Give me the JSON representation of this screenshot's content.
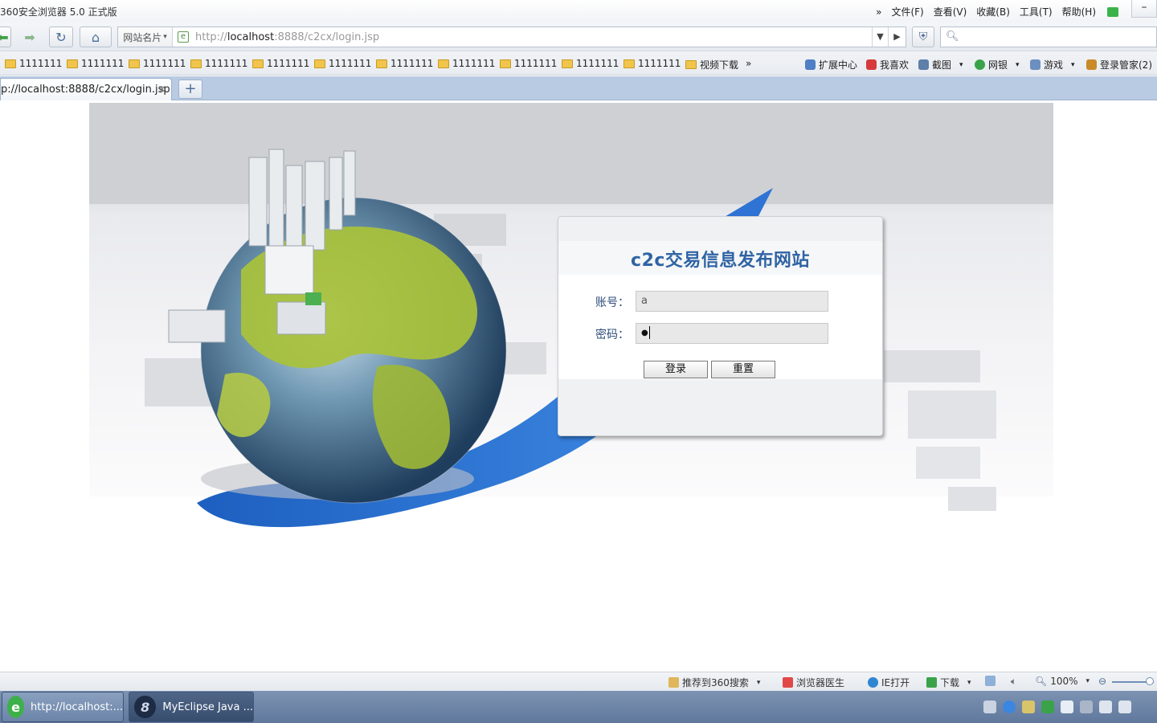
{
  "window": {
    "title": "360安全浏览器 5.0 正式版",
    "menus": [
      "文件(F)",
      "查看(V)",
      "收藏(B)",
      "工具(T)",
      "帮助(H)"
    ],
    "minimize": "–"
  },
  "nav": {
    "sites_label": "网站名片",
    "url_prefix": "http://",
    "url_host": "localhost",
    "url_rest": ":8888/c2cx/login.jsp",
    "search_placeholder": ""
  },
  "bookmarks": {
    "items": [
      "1111111",
      "1111111",
      "1111111",
      "1111111",
      "1111111",
      "1111111",
      "1111111",
      "1111111",
      "1111111",
      "1111111",
      "1111111",
      "视频下载"
    ],
    "more": "»",
    "right": [
      "扩展中心",
      "我喜欢",
      "截图",
      "网银",
      "游戏",
      "登录管家(2)"
    ]
  },
  "tabs": {
    "active_label": "p://localhost:8888/c2cx/login.jsp",
    "close": "×",
    "new_tab": "+"
  },
  "login": {
    "title": "c2c交易信息发布网站",
    "account_label": "账号：",
    "account_value": "a",
    "password_label": "密码：",
    "password_value": "●",
    "login_button": "登录",
    "reset_button": "重置"
  },
  "status": {
    "recommend": "推荐到360搜索",
    "doctor": "浏览器医生",
    "ie_open": "IE打开",
    "download": "下载",
    "zoom": "100%"
  },
  "taskbar": {
    "task1": "http://localhost:...",
    "task2": "MyEclipse Java ..."
  },
  "colors": {
    "accent": "#2f64a4",
    "tabbar": "#b9cbe2",
    "taskbar": "#6b84a8"
  }
}
